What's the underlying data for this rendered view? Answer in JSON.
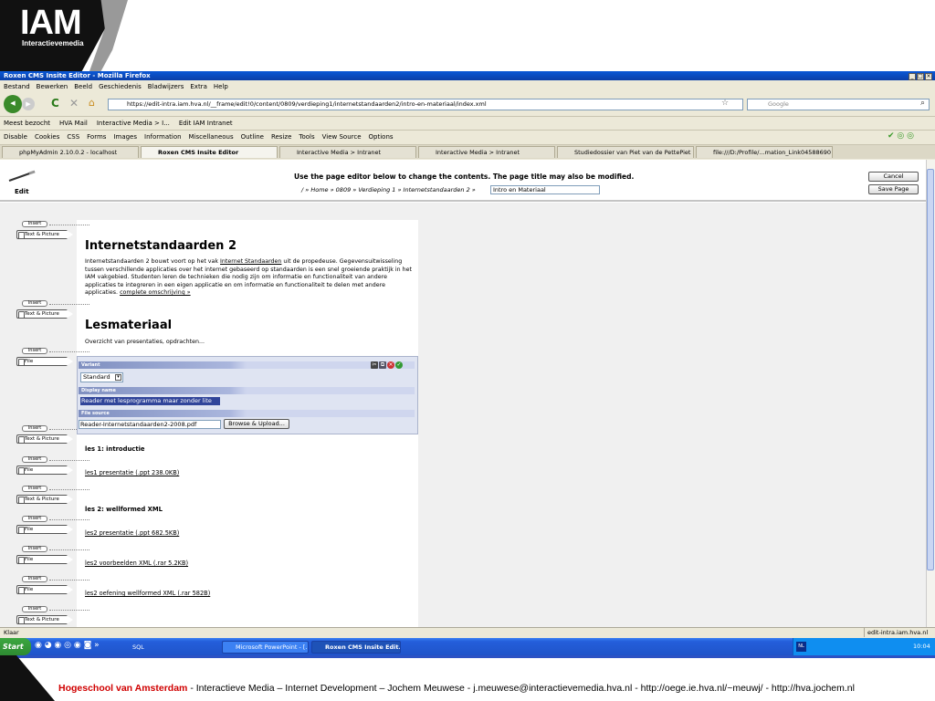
{
  "logo": {
    "main": "IAM",
    "sub": "Interactievemedia"
  },
  "window": {
    "title": "Roxen CMS Insite Editor - Mozilla Firefox"
  },
  "menu": [
    "Bestand",
    "Bewerken",
    "Beeld",
    "Geschiedenis",
    "Bladwijzers",
    "Extra",
    "Help"
  ],
  "nav": {
    "url": "https://edit-intra.iam.hva.nl/__frame/edit!0/content/0809/verdieping1/internetstandaarden2/intro-en-materiaal/index.xml",
    "search_placeholder": "Google"
  },
  "bookmarks": [
    "Meest bezocht",
    "HVA Mail",
    "Interactive Media > I...",
    "Edit IAM Intranet"
  ],
  "webdev": [
    "Disable",
    "Cookies",
    "CSS",
    "Forms",
    "Images",
    "Information",
    "Miscellaneous",
    "Outline",
    "Resize",
    "Tools",
    "View Source",
    "Options"
  ],
  "tabs": [
    "phpMyAdmin 2.10.0.2 - localhost",
    "Roxen CMS Insite Editor",
    "Interactive Media > Intranet",
    "Interactive Media > Intranet",
    "Studiedossier van Piet van de PettePiet",
    "file:///D:/Profile/...mation_Link04588690"
  ],
  "editor": {
    "edit_label": "Edit",
    "instruction": "Use the page editor below to change the contents. The page title may also be modified.",
    "breadcrumb": "/ » Home » 0809 » Verdieping 1 » Internetstandaarden 2 »",
    "page_title_value": "Intro en Materiaal",
    "cancel": "Cancel",
    "save": "Save Page"
  },
  "inserts": {
    "insert": "Insert",
    "text_picture": "Text & Picture",
    "file": "File"
  },
  "content": {
    "h1": "Internetstandaarden 2",
    "intro_a": "Internetstandaarden 2  bouwt voort op het vak ",
    "intro_link": "Internet Standaarden",
    "intro_b": " uit de propedeuse. Gegevensuitwisseling tussen verschillende applicaties over het internet gebaseerd op standaarden is een snel groeiende praktijk in het IAM vakgebied. Studenten leren de technieken die nodig zijn om informatie en functionaliteit van andere applicaties te integreren in een eigen applicatie en om informatie en functionaliteit te delen met andere applicaties. ",
    "intro_more": "complete omschrijving »",
    "h2": "Lesmateriaal",
    "overzicht": "Overzicht van presentaties, opdrachten...",
    "variant_label": "Variant",
    "variant_value": "Standard",
    "display_label": "Display name",
    "display_value": "Reader met lesprogramma maar zonder lite",
    "source_label": "File source",
    "source_value": "Reader-Internetstandaarden2-2008.pdf",
    "browse": "Browse & Upload...",
    "les1": "les 1: introductie",
    "les1_link": "les1 presentatie (.ppt 238.0KB)",
    "les2": "les 2: wellformed XML",
    "les2_link1": "les2 presentatie (.ppt 682.5KB)",
    "les2_link2": "les2 voorbeelden XML (.rar 5.2KB)",
    "les2_link3": "les2 oefening wellformed XML (.rar 582B)"
  },
  "status": {
    "left": "Klaar",
    "right": "edit-intra.iam.hva.nl"
  },
  "taskbar": {
    "start": "Start",
    "sql": "SQL",
    "ppt": "Microsoft PowerPoint - [...",
    "roxen": "Roxen CMS Insite Edit...",
    "clock": "10:04",
    "nl": "NL"
  },
  "footer": {
    "school": "Hogeschool van Amsterdam",
    "rest": " - Interactieve Media – Internet Development – Jochem Meuwese - j.meuwese@interactievemedia.hva.nl - http://oege.ie.hva.nl/~meuwj/ - http://hva.jochem.nl"
  }
}
